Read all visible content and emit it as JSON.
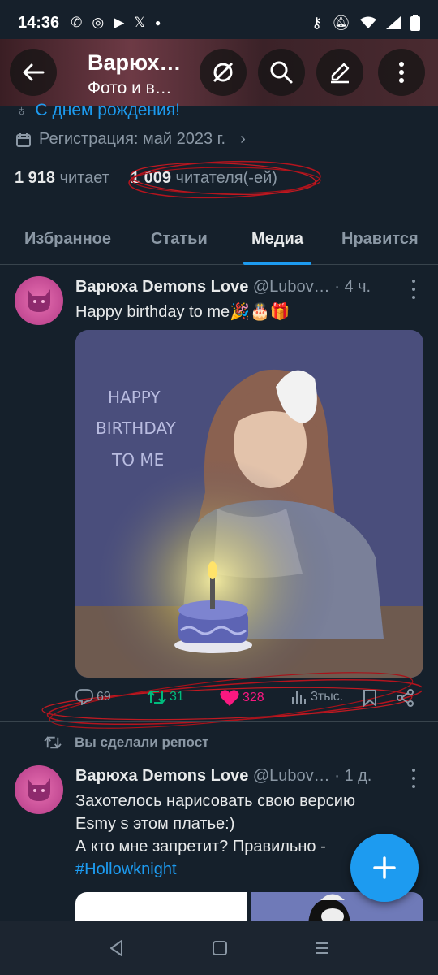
{
  "status": {
    "time": "14:36",
    "apps": [
      "whatsapp-icon",
      "instagram-icon",
      "youtube-icon",
      "x-icon",
      "dot-icon"
    ],
    "right": [
      "key-icon",
      "mute-icon",
      "wifi-icon",
      "signal-icon",
      "battery-icon"
    ]
  },
  "header": {
    "name": "Варюх…",
    "subtitle": "Фото и в…",
    "buttons": [
      "grok-icon",
      "search-icon",
      "edit-icon",
      "more-icon"
    ]
  },
  "profile": {
    "birthday": "С днем рождения!",
    "registration": "Регистрация: май 2023 г.",
    "following_count": "1 918",
    "following_label": "читает",
    "followers_count": "1 009",
    "followers_label": "читателя(-ей)"
  },
  "tabs": [
    {
      "label": "Избранное",
      "active": false
    },
    {
      "label": "Статьи",
      "active": false
    },
    {
      "label": "Медиа",
      "active": true
    },
    {
      "label": "Нравится",
      "active": false
    }
  ],
  "tweet1": {
    "name": "Варюха Demons Love",
    "handle": "@Lubov…",
    "time": "· 4 ч.",
    "text": "Happy birthday to me🎉🎂🎁",
    "image_text": [
      "HAPPY",
      "BIRTHDAY",
      "TO ME"
    ],
    "replies": "69",
    "reposts": "31",
    "likes": "328",
    "views": "3тыс."
  },
  "repost_notice": "Вы сделали репост",
  "tweet2": {
    "name": "Варюха Demons Love",
    "handle": "@Lubov…",
    "time": "· 1 д.",
    "line1": "Захотелось нарисовать свою версию",
    "line2": "Esmy s этом платье:)",
    "line3": "А кто мне запретит? Правильно -",
    "hashtag": "#Hollowknight"
  },
  "colors": {
    "background": "#15202b",
    "accent": "#1d9bf0",
    "like": "#f91880",
    "repost": "#00ba7c",
    "secondary_text": "#8b98a5"
  }
}
